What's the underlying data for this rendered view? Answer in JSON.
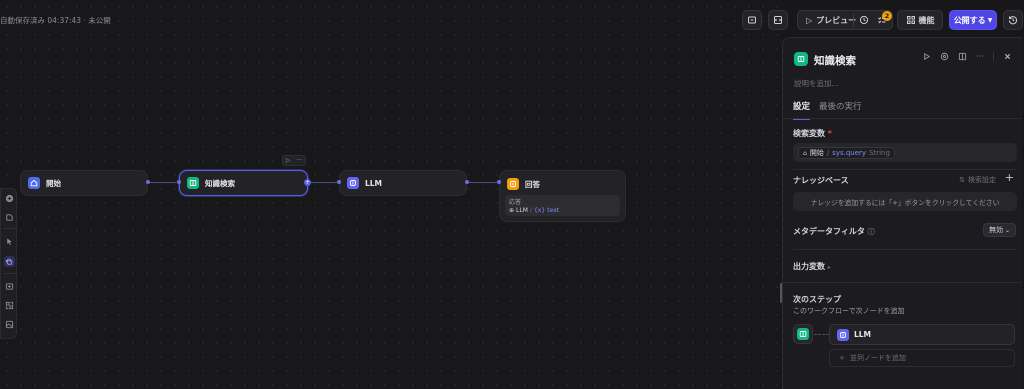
{
  "header": {
    "autosave_text": "自動保存済み 04:37:43 · 未公開",
    "preview_label": "プレビュー",
    "checklist_badge": "2",
    "features_label": "機能",
    "publish_label": "公開する"
  },
  "nodes": {
    "start": {
      "title": "開始"
    },
    "knowledge": {
      "title": "知識検索"
    },
    "llm": {
      "title": "LLM"
    },
    "answer": {
      "title": "回答",
      "response_label": "応答",
      "var_source": "LLM",
      "var_name": "text"
    }
  },
  "panel": {
    "title": "知識検索",
    "description_placeholder": "説明を追加...",
    "tabs": [
      {
        "label": "設定"
      },
      {
        "label": "最後の実行"
      }
    ],
    "query_var_label": "検索変数",
    "query_required": "*",
    "query_chip": {
      "node": "開始",
      "path": "sys.query",
      "type": "String"
    },
    "knowledge_label": "ナレッジベース",
    "retrieval_settings_label": "検索設定",
    "knowledge_empty_text": "ナレッジを追加するには「+」ボタンをクリックしてください",
    "metadata_filter_label": "メタデータフィルタ",
    "metadata_filter_value": "無効",
    "output_vars_label": "出力変数",
    "next_step_label": "次のステップ",
    "next_step_desc": "このワークフローで次ノードを追加",
    "next_node_label": "LLM",
    "add_parallel_label": "並列ノードを追加"
  },
  "colors": {
    "accent": "#5b5fe8",
    "knowledge_green": "#10b981",
    "start_blue": "#4f6bf0",
    "llm_indigo": "#6366f1",
    "answer_orange": "#f59e0b"
  }
}
